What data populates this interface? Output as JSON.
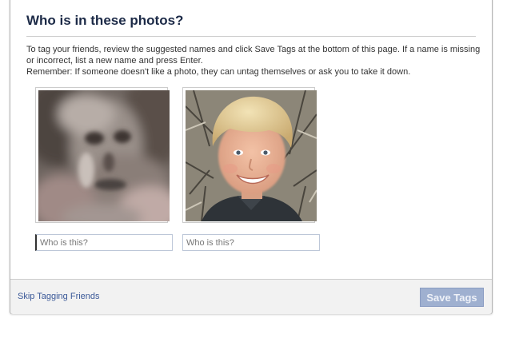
{
  "dialog": {
    "title": "Who is in these photos?",
    "intro_line1": "To tag your friends, review the suggested names and click Save Tags at the bottom of this page. If a name is missing or incorrect, list a new name and press Enter.",
    "intro_line2": "Remember: If someone doesn't like a photo, they can untag themselves or ask you to take it down."
  },
  "photos": [
    {
      "subject": "blurry-face-photo",
      "input_placeholder": "Who is this?",
      "input_value": ""
    },
    {
      "subject": "smiling-boy-photo",
      "input_placeholder": "Who is this?",
      "input_value": ""
    }
  ],
  "footer": {
    "skip_label": "Skip Tagging Friends",
    "save_label": "Save Tags"
  },
  "colors": {
    "title": "#1c2a47",
    "link": "#3b5998",
    "save_button_disabled": "#9fb0d0",
    "footer_bg": "#f2f2f2"
  }
}
